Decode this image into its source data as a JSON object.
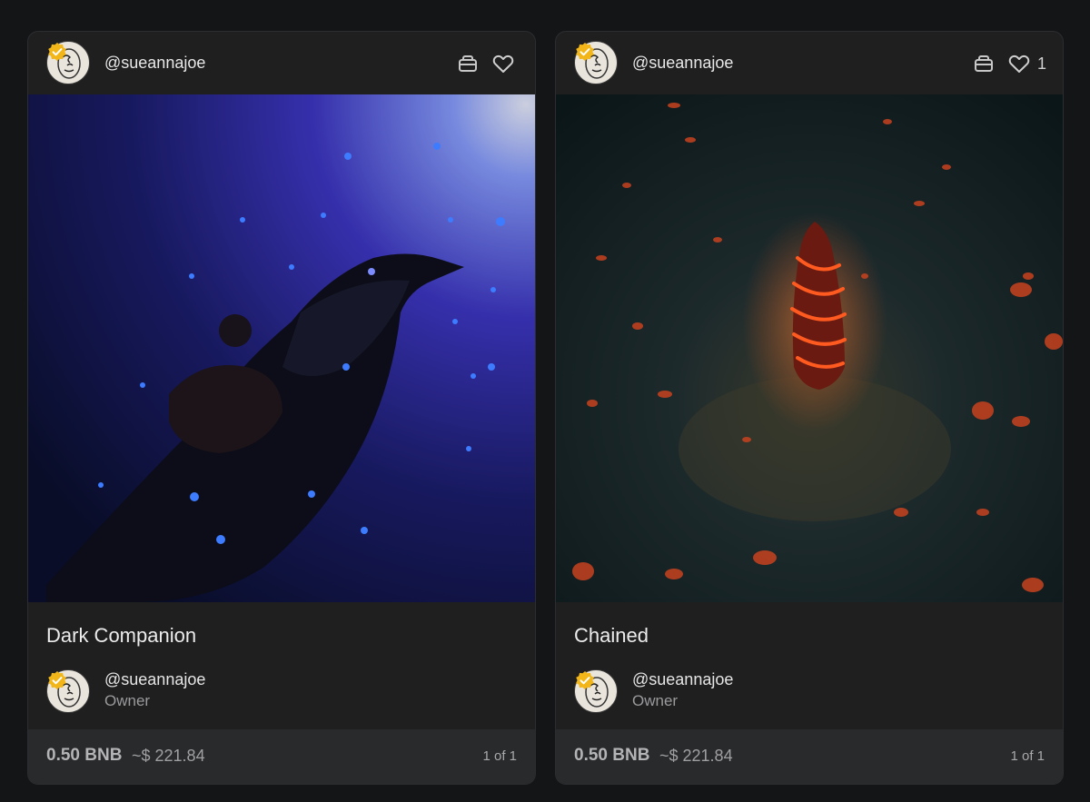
{
  "cards": [
    {
      "creator": "@sueannajoe",
      "likes": "",
      "title": "Dark Companion",
      "owner_name": "@sueannajoe",
      "owner_role": "Owner",
      "price": "0.50 BNB",
      "usd": "~$ 221.84",
      "edition": "1 of 1"
    },
    {
      "creator": "@sueannajoe",
      "likes": "1",
      "title": "Chained",
      "owner_name": "@sueannajoe",
      "owner_role": "Owner",
      "price": "0.50 BNB",
      "usd": "~$ 221.84",
      "edition": "1 of 1"
    }
  ],
  "icons": {
    "cart": "cart-icon",
    "like": "heart-icon",
    "verified": "verified-badge-icon"
  },
  "colors": {
    "background": "#141517",
    "card": "#1f1f20",
    "footer": "#292a2c",
    "verified": "#f2b619"
  }
}
